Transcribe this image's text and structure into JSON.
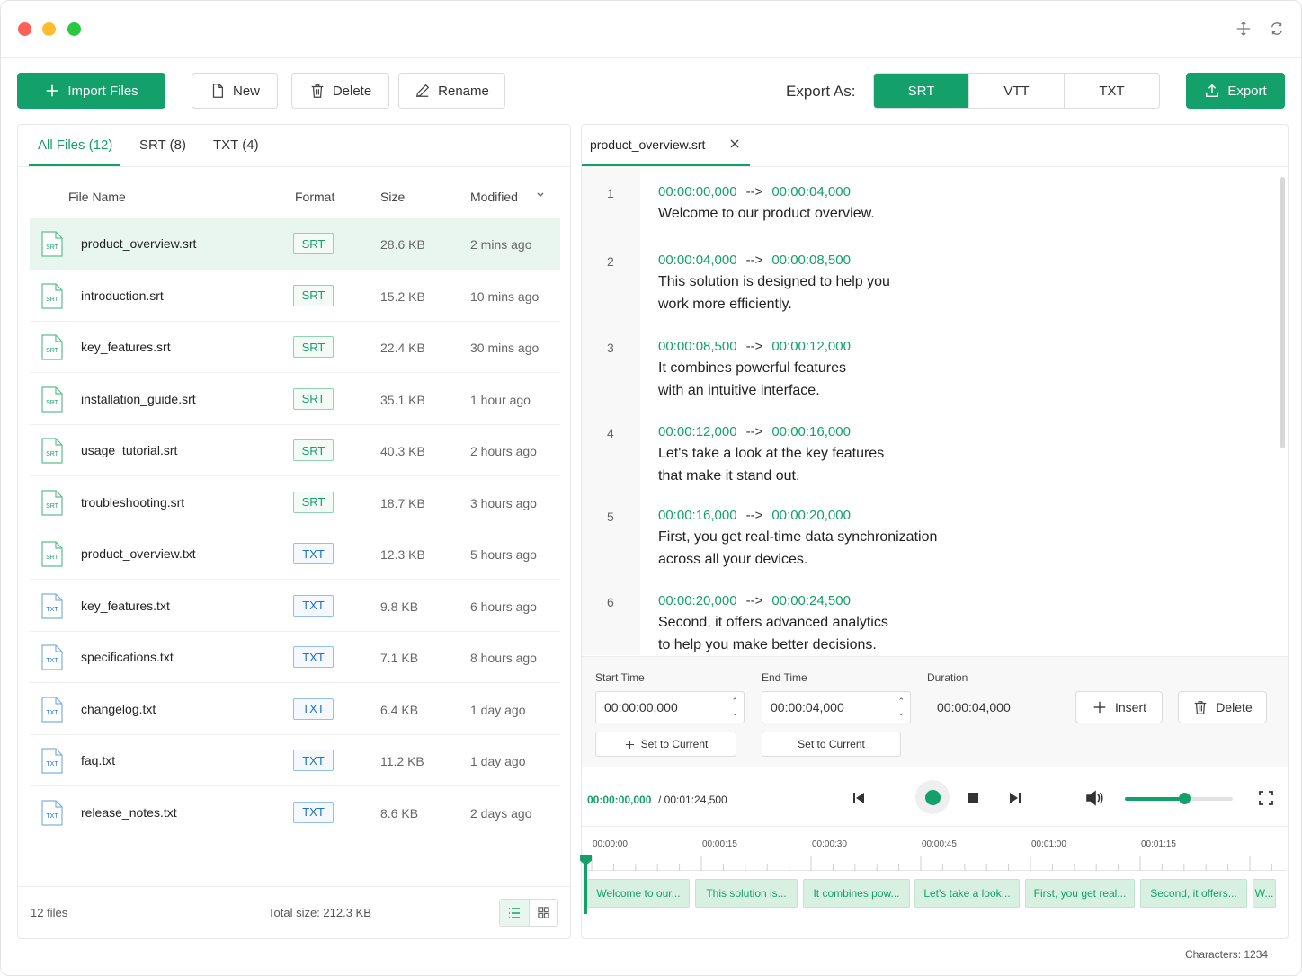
{
  "toolbar": {
    "import_label": "Import Files",
    "new_label": "New",
    "delete_label": "Delete",
    "rename_label": "Rename",
    "export_as_label": "Export As:",
    "formats": [
      "SRT",
      "VTT",
      "TXT"
    ],
    "active_format": "SRT",
    "export_label": "Export"
  },
  "file_tabs": {
    "all": "All Files (12)",
    "srt": "SRT (8)",
    "txt": "TXT (4)"
  },
  "table": {
    "col_name": "File Name",
    "col_format": "Format",
    "col_size": "Size",
    "col_modified": "Modified"
  },
  "files": [
    {
      "name": "product_overview.srt",
      "format": "SRT",
      "size": "28.6 KB",
      "modified": "2 mins ago",
      "icon": "SRT"
    },
    {
      "name": "introduction.srt",
      "format": "SRT",
      "size": "15.2 KB",
      "modified": "10 mins ago",
      "icon": "SRT"
    },
    {
      "name": "key_features.srt",
      "format": "SRT",
      "size": "22.4 KB",
      "modified": "30 mins ago",
      "icon": "SRT"
    },
    {
      "name": "installation_guide.srt",
      "format": "SRT",
      "size": "35.1 KB",
      "modified": "1 hour ago",
      "icon": "SRT"
    },
    {
      "name": "usage_tutorial.srt",
      "format": "SRT",
      "size": "40.3 KB",
      "modified": "2 hours ago",
      "icon": "SRT"
    },
    {
      "name": "troubleshooting.srt",
      "format": "SRT",
      "size": "18.7 KB",
      "modified": "3 hours ago",
      "icon": "SRT"
    },
    {
      "name": "product_overview.txt",
      "format": "TXT",
      "size": "12.3 KB",
      "modified": "5 hours ago",
      "icon": "SRT"
    },
    {
      "name": "key_features.txt",
      "format": "TXT",
      "size": "9.8 KB",
      "modified": "6 hours ago",
      "icon": "TXT"
    },
    {
      "name": "specifications.txt",
      "format": "TXT",
      "size": "7.1 KB",
      "modified": "8 hours ago",
      "icon": "TXT"
    },
    {
      "name": "changelog.txt",
      "format": "TXT",
      "size": "6.4 KB",
      "modified": "1 day ago",
      "icon": "TXT"
    },
    {
      "name": "faq.txt",
      "format": "TXT",
      "size": "11.2 KB",
      "modified": "1 day ago",
      "icon": "TXT"
    },
    {
      "name": "release_notes.txt",
      "format": "TXT",
      "size": "8.6 KB",
      "modified": "2 days ago",
      "icon": "TXT"
    }
  ],
  "left_footer": {
    "count": "12 files",
    "total": "Total size: 212.3 KB"
  },
  "editor": {
    "tab_name": "product_overview.srt",
    "arrow": "-->",
    "subtitles": [
      {
        "num": "1",
        "start": "00:00:00,000",
        "end": "00:00:04,000",
        "lines": [
          "Welcome to our product overview."
        ]
      },
      {
        "num": "2",
        "start": "00:00:04,000",
        "end": "00:00:08,500",
        "lines": [
          "This solution is designed to help you",
          "work more efficiently."
        ]
      },
      {
        "num": "3",
        "start": "00:00:08,500",
        "end": "00:00:12,000",
        "lines": [
          "It combines powerful features",
          "with an intuitive interface."
        ]
      },
      {
        "num": "4",
        "start": "00:00:12,000",
        "end": "00:00:16,000",
        "lines": [
          "Let's take a look at the key features",
          "that make it stand out."
        ]
      },
      {
        "num": "5",
        "start": "00:00:16,000",
        "end": "00:00:20,000",
        "lines": [
          "First, you get real-time data synchronization",
          "across all your devices."
        ]
      },
      {
        "num": "6",
        "start": "00:00:20,000",
        "end": "00:00:24,500",
        "lines": [
          "Second, it offers advanced analytics",
          "to help you make better decisions."
        ]
      }
    ]
  },
  "timing": {
    "start_label": "Start Time",
    "end_label": "End Time",
    "duration_label": "Duration",
    "start_value": "00:00:00,000",
    "end_value": "00:00:04,000",
    "duration_value": "00:00:04,000",
    "insert_label": "Insert",
    "delete_label": "Delete",
    "set_current_label": "Set to Current"
  },
  "player": {
    "current": "00:00:00,000",
    "total": "/ 00:01:24,500",
    "volume": 0.55
  },
  "timeline": {
    "ticks": [
      "00:00:00",
      "00:00:15",
      "00:00:30",
      "00:00:45",
      "00:01:00",
      "00:01:15"
    ],
    "chips": [
      "Welcome to our...",
      "This solution is...",
      "It combines pow...",
      "Let's take a look...",
      "First, you get real...",
      "Second, it offers...",
      "W..."
    ]
  },
  "status": {
    "characters": "Characters: 1234"
  },
  "colors": {
    "accent": "#14a06a",
    "txt_badge": "#1a73c9"
  }
}
